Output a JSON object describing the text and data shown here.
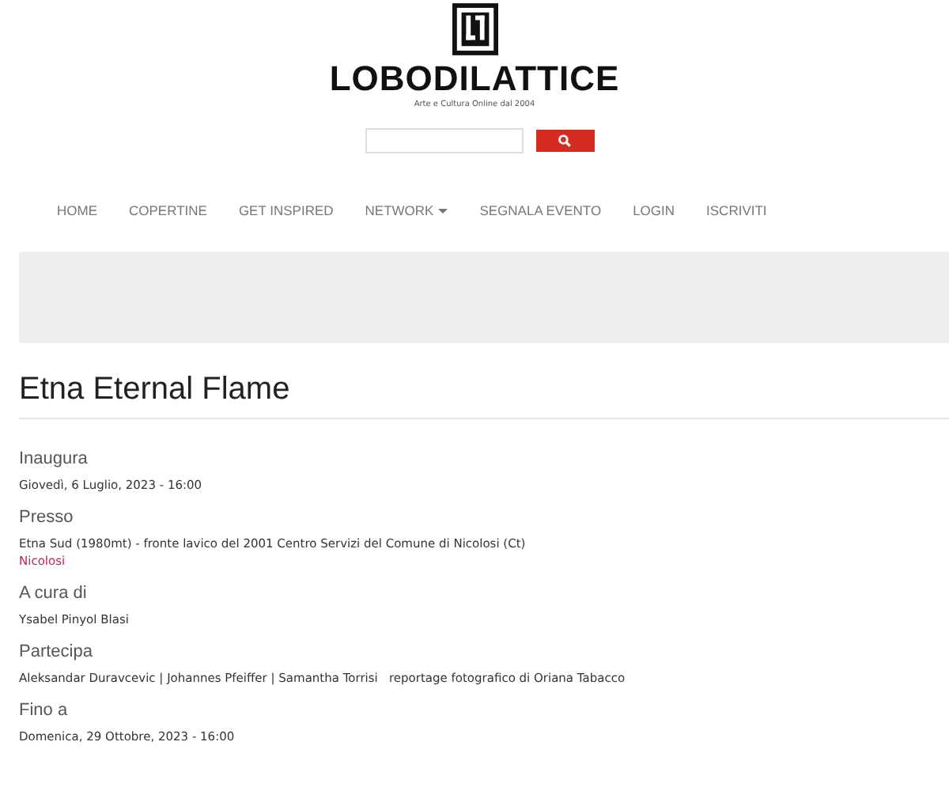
{
  "logo": {
    "name": "LOBODILATTICE",
    "tagline": "Arte e Cultura Online dal 2004"
  },
  "nav": [
    {
      "label": "HOME",
      "dropdown": false
    },
    {
      "label": "COPERTINE",
      "dropdown": false
    },
    {
      "label": "GET INSPIRED",
      "dropdown": false
    },
    {
      "label": "NETWORK",
      "dropdown": true
    },
    {
      "label": "SEGNALA EVENTO",
      "dropdown": false
    },
    {
      "label": "LOGIN",
      "dropdown": false
    },
    {
      "label": "ISCRIVITI",
      "dropdown": false
    }
  ],
  "title": "Etna Eternal Flame",
  "sections": [
    {
      "label": "Inaugura",
      "value": "Giovedì, 6 Luglio, 2023 - 16:00"
    },
    {
      "label": "Presso",
      "value": "Etna Sud (1980mt) - fronte lavico del 2001 Centro Servizi del Comune di Nicolosi (Ct)",
      "link": "Nicolosi"
    },
    {
      "label": "A cura di",
      "value": "Ysabel Pinyol Blasi"
    },
    {
      "label": "Partecipa",
      "value": "Aleksandar Duravcevic | Johannes Pfeiffer | Samantha Torrisi   reportage fotografico di Oriana Tabacco"
    },
    {
      "label": "Fino a",
      "value": "Domenica, 29 Ottobre, 2023 - 16:00"
    }
  ]
}
